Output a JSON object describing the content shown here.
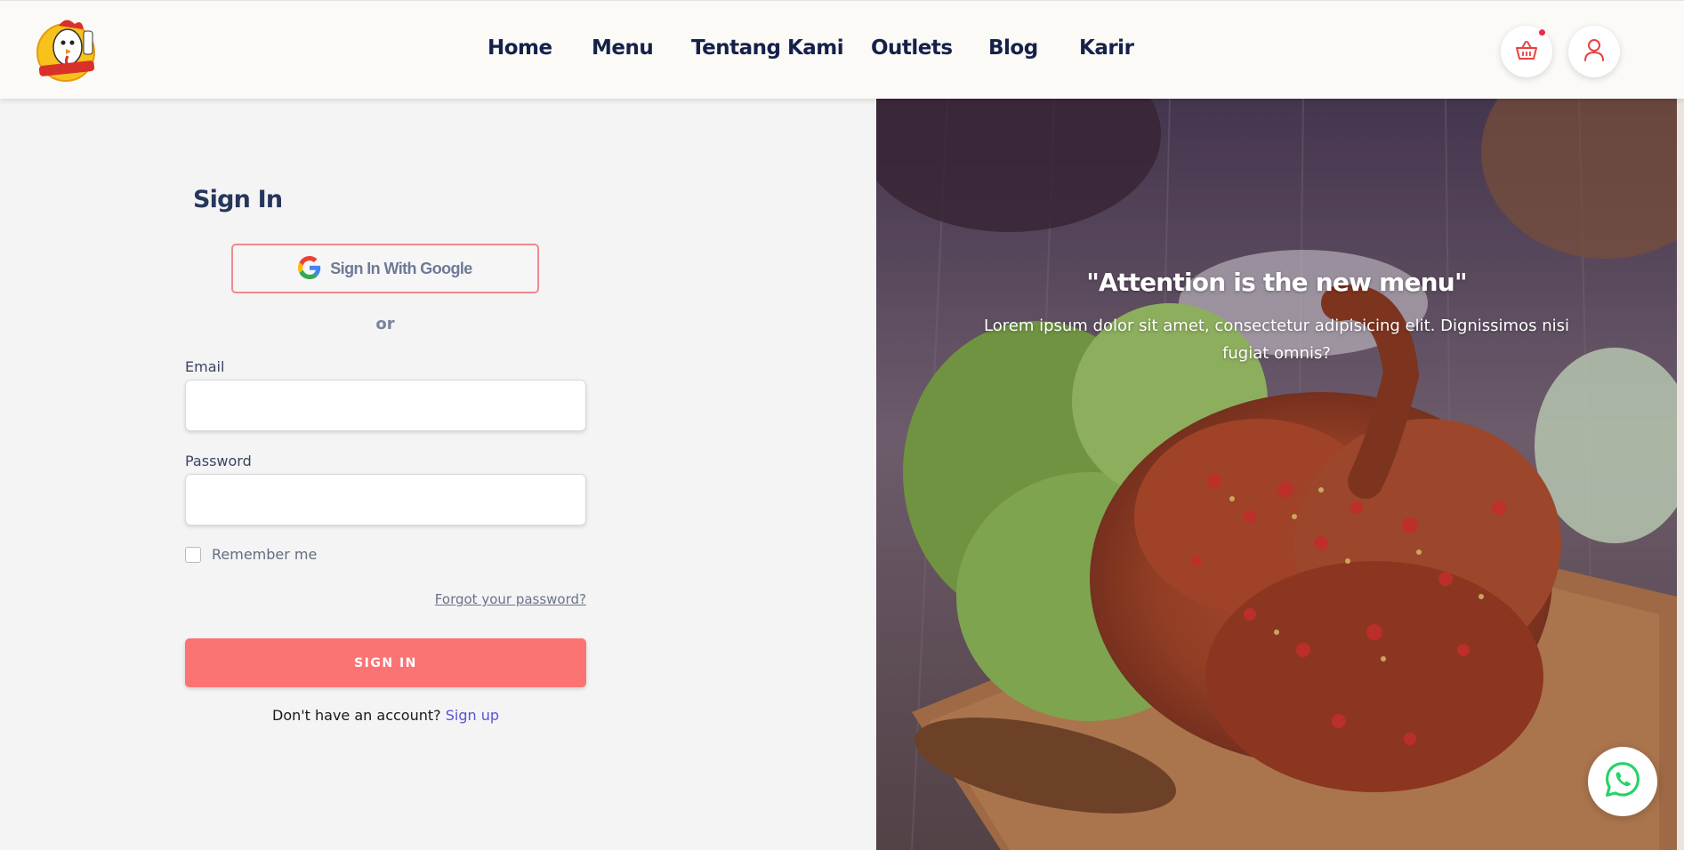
{
  "nav": {
    "links": [
      "Home",
      "Menu",
      "Tentang Kami",
      "Outlets",
      "Blog",
      "Karir"
    ],
    "cart_icon": "basket-icon",
    "user_icon": "user-icon",
    "logo_icon": "rooster-chef-logo"
  },
  "signin": {
    "title": "Sign In",
    "google_label": "Sign In With Google",
    "or_label": "or",
    "email_label": "Email",
    "email_value": "",
    "password_label": "Password",
    "password_value": "",
    "remember_label": "Remember me",
    "forgot_label": "Forgot your password?",
    "submit_label": "SIGN IN",
    "no_account_label": "Don't have an account?",
    "signup_label": "Sign up"
  },
  "hero": {
    "quote": "\"Attention is the new menu\"",
    "subtitle": "Lorem ipsum dolor sit amet, consectetur adipisicing elit. Dignissimos nisi fugiat omnis?"
  },
  "colors": {
    "accent": "#fb7373",
    "nav_text": "#16214a",
    "link": "#5b52d6",
    "whatsapp": "#25d366"
  },
  "whatsapp_icon": "whatsapp-icon"
}
